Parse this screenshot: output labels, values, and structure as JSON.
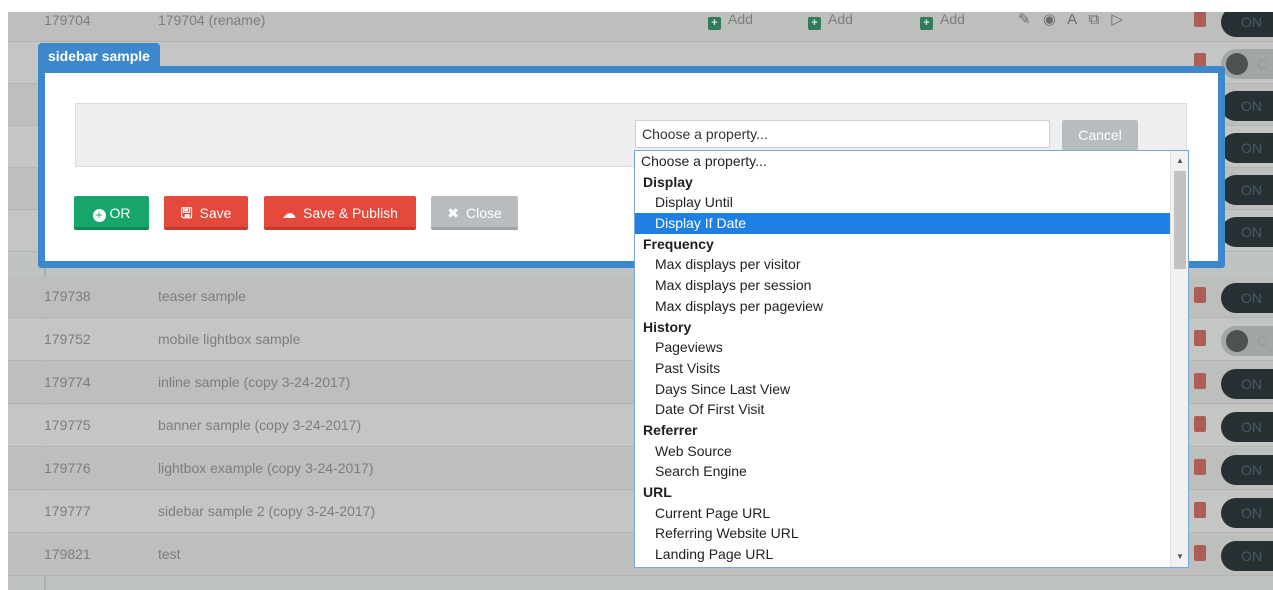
{
  "background_table": {
    "rows": [
      {
        "id": "179704",
        "name": "179704 (rename)",
        "toggle": "ON"
      },
      {
        "id": "",
        "name": "",
        "toggle": "C"
      },
      {
        "id": "",
        "name": "",
        "toggle": "ON"
      },
      {
        "id": "",
        "name": "",
        "toggle": "ON"
      },
      {
        "id": "",
        "name": "",
        "toggle": "ON"
      },
      {
        "id": "",
        "name": "",
        "toggle": "ON"
      },
      {
        "id": "179738",
        "name": "teaser sample",
        "toggle": "ON"
      },
      {
        "id": "179752",
        "name": "mobile lightbox sample",
        "toggle": "C"
      },
      {
        "id": "179774",
        "name": "inline sample (copy 3-24-2017)",
        "toggle": "ON"
      },
      {
        "id": "179775",
        "name": "banner sample (copy 3-24-2017)",
        "toggle": "ON"
      },
      {
        "id": "179776",
        "name": "lightbox example (copy 3-24-2017)",
        "toggle": "ON"
      },
      {
        "id": "179777",
        "name": "sidebar sample 2 (copy 3-24-2017)",
        "toggle": "ON"
      },
      {
        "id": "179821",
        "name": "test",
        "toggle": "ON"
      }
    ],
    "add_label": "Add",
    "action_icons": "✎ ◉ A ⧉ ▷"
  },
  "dialog": {
    "tab_title": "sidebar sample",
    "property_select_value": "Choose a property...",
    "cancel_label": "Cancel",
    "buttons": {
      "or": "OR",
      "save": "Save",
      "save_publish": "Save & Publish",
      "close": "Close"
    }
  },
  "property_dropdown": {
    "items": [
      {
        "label": "Choose a property...",
        "kind": "first"
      },
      {
        "label": "Display",
        "kind": "group"
      },
      {
        "label": "Display Until",
        "kind": "opt"
      },
      {
        "label": "Display If Date",
        "kind": "opt",
        "selected": true
      },
      {
        "label": "Frequency",
        "kind": "group"
      },
      {
        "label": "Max displays per visitor",
        "kind": "opt"
      },
      {
        "label": "Max displays per session",
        "kind": "opt"
      },
      {
        "label": "Max displays per pageview",
        "kind": "opt"
      },
      {
        "label": "History",
        "kind": "group"
      },
      {
        "label": "Pageviews",
        "kind": "opt"
      },
      {
        "label": "Past Visits",
        "kind": "opt"
      },
      {
        "label": "Days Since Last View",
        "kind": "opt"
      },
      {
        "label": "Date Of First Visit",
        "kind": "opt"
      },
      {
        "label": "Referrer",
        "kind": "group"
      },
      {
        "label": "Web Source",
        "kind": "opt"
      },
      {
        "label": "Search Engine",
        "kind": "opt"
      },
      {
        "label": "URL",
        "kind": "group"
      },
      {
        "label": "Current Page URL",
        "kind": "opt"
      },
      {
        "label": "Referring Website URL",
        "kind": "opt"
      },
      {
        "label": "Landing Page URL",
        "kind": "opt"
      }
    ]
  },
  "colors": {
    "dialog_accent": "#3d88cd",
    "or_button": "#16a56a",
    "save_button": "#e4493c",
    "close_button": "#b8bcbf",
    "selected_option": "#1e7fe4"
  }
}
